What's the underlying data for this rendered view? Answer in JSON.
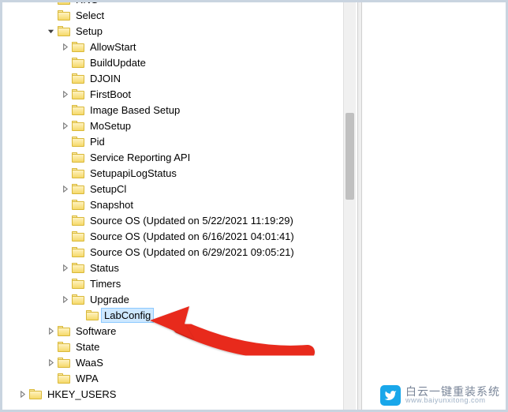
{
  "tree": {
    "nodes": [
      {
        "depth": 3,
        "expander": "none",
        "label": "RNG"
      },
      {
        "depth": 3,
        "expander": "none",
        "label": "Select"
      },
      {
        "depth": 3,
        "expander": "open",
        "label": "Setup"
      },
      {
        "depth": 4,
        "expander": "closed",
        "label": "AllowStart"
      },
      {
        "depth": 4,
        "expander": "none",
        "label": "BuildUpdate"
      },
      {
        "depth": 4,
        "expander": "none",
        "label": "DJOIN"
      },
      {
        "depth": 4,
        "expander": "closed",
        "label": "FirstBoot"
      },
      {
        "depth": 4,
        "expander": "none",
        "label": "Image Based Setup"
      },
      {
        "depth": 4,
        "expander": "closed",
        "label": "MoSetup"
      },
      {
        "depth": 4,
        "expander": "none",
        "label": "Pid"
      },
      {
        "depth": 4,
        "expander": "none",
        "label": "Service Reporting API"
      },
      {
        "depth": 4,
        "expander": "none",
        "label": "SetupapiLogStatus"
      },
      {
        "depth": 4,
        "expander": "closed",
        "label": "SetupCl"
      },
      {
        "depth": 4,
        "expander": "none",
        "label": "Snapshot"
      },
      {
        "depth": 4,
        "expander": "none",
        "label": "Source OS (Updated on 5/22/2021 11:19:29)"
      },
      {
        "depth": 4,
        "expander": "none",
        "label": "Source OS (Updated on 6/16/2021 04:01:41)"
      },
      {
        "depth": 4,
        "expander": "none",
        "label": "Source OS (Updated on 6/29/2021 09:05:21)"
      },
      {
        "depth": 4,
        "expander": "closed",
        "label": "Status"
      },
      {
        "depth": 4,
        "expander": "none",
        "label": "Timers"
      },
      {
        "depth": 4,
        "expander": "closed",
        "label": "Upgrade"
      },
      {
        "depth": 5,
        "expander": "none",
        "label": "LabConfig",
        "selected": true
      },
      {
        "depth": 3,
        "expander": "closed",
        "label": "Software"
      },
      {
        "depth": 3,
        "expander": "none",
        "label": "State"
      },
      {
        "depth": 3,
        "expander": "closed",
        "label": "WaaS"
      },
      {
        "depth": 3,
        "expander": "none",
        "label": "WPA"
      },
      {
        "depth": 1,
        "expander": "closed",
        "label": "HKEY_USERS"
      }
    ]
  },
  "annotation": {
    "arrow_color": "#e8291f"
  },
  "watermark": {
    "brand_cn": "白云一键重装系统",
    "url": "www.baiyunxitong.com",
    "badge_color": "#19a7ea"
  }
}
